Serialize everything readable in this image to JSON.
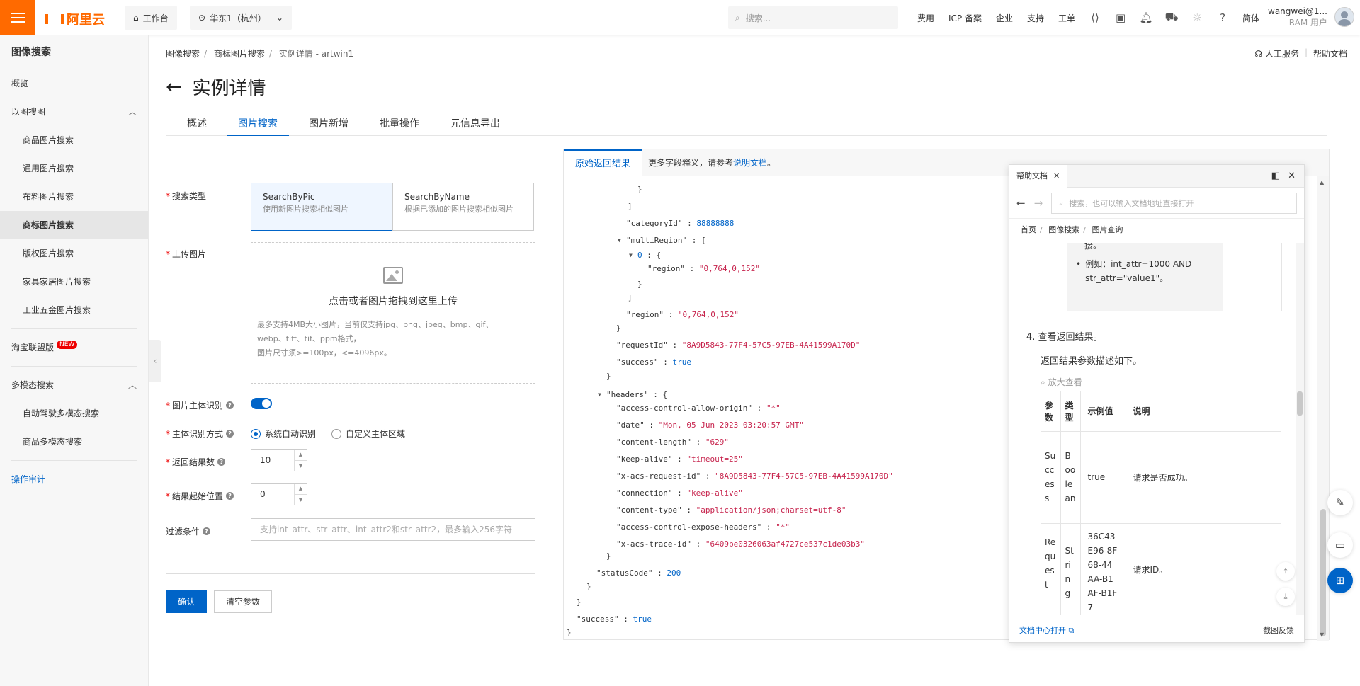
{
  "topbar": {
    "logo": "阿里云",
    "workbench": "工作台",
    "region": "华东1（杭州）",
    "search_placeholder": "搜索...",
    "links": [
      "费用",
      "ICP 备案",
      "企业",
      "支持",
      "工单"
    ],
    "lang": "简体",
    "user_name": "wangwei@1...",
    "user_role": "RAM 用户",
    "accent_color": "#ff6a00"
  },
  "sidebar": {
    "title": "图像搜索",
    "overview": "概览",
    "group1": "以图搜图",
    "group1_items": [
      "商品图片搜索",
      "通用图片搜索",
      "布料图片搜索",
      "商标图片搜索",
      "版权图片搜索",
      "家具家居图片搜索",
      "工业五金图片搜索"
    ],
    "taobao": "淘宝联盟版",
    "new_badge": "NEW",
    "group2": "多模态搜索",
    "group2_items": [
      "自动驾驶多模态搜索",
      "商品多模态搜索"
    ],
    "audit": "操作审计"
  },
  "header": {
    "breadcrumb": [
      "图像搜索",
      "商标图片搜索",
      "实例详情 - artwin1"
    ],
    "help_service": "人工服务",
    "help_doc": "帮助文档",
    "title": "实例详情",
    "tabs": [
      "概述",
      "图片搜索",
      "图片新增",
      "批量操作",
      "元信息导出"
    ],
    "active_tab": "图片搜索"
  },
  "form": {
    "search_type_label": "搜索类型",
    "search_types": [
      {
        "name": "SearchByPic",
        "desc": "使用新图片搜索相似图片"
      },
      {
        "name": "SearchByName",
        "desc": "根据已添加的图片搜索相似图片"
      }
    ],
    "upload_label": "上传图片",
    "upload_main": "点击或者图片拖拽到这里上传",
    "upload_hint1": "最多支持4MB大小图片，当前仅支持jpg、png、jpeg、bmp、gif、",
    "upload_hint2": "webp、tiff、tif、ppm格式，",
    "upload_hint3": "图片尺寸须>=100px，<=4096px。",
    "subject_label": "图片主体识别",
    "subject_mode_label": "主体识别方式",
    "subject_modes": [
      "系统自动识别",
      "自定义主体区域"
    ],
    "result_count_label": "返回结果数",
    "result_count": "10",
    "start_label": "结果起始位置",
    "start": "0",
    "filter_label": "过滤条件",
    "filter_placeholder": "支持int_attr、str_attr、int_attr2和str_attr2，最多输入256字符",
    "confirm": "确认",
    "clear": "清空参数"
  },
  "result": {
    "tab": "原始返回结果",
    "note_prefix": "更多字段释义，请参考",
    "note_link": "说明文档",
    "note_suffix": "。",
    "json_lines": [
      {
        "t": "}"
      },
      {
        "t": "]"
      },
      {
        "k": "categoryId",
        "v": "88888888",
        "vt": "n"
      },
      {
        "k": "multiRegion",
        "v": "[",
        "vt": "b",
        "toggle": true
      },
      {
        "k": "0",
        "v": "{",
        "vt": "b",
        "toggle": true,
        "kn": true
      },
      {
        "k": "region",
        "v": "\"0,764,0,152\"",
        "vt": "s"
      },
      {
        "t": "}"
      },
      {
        "t": "]"
      },
      {
        "k": "region",
        "v": "\"0,764,0,152\"",
        "vt": "s"
      },
      {
        "t": "}"
      },
      {
        "k": "requestId",
        "v": "\"8A9D5843-77F4-57C5-97EB-4A41599A170D\"",
        "vt": "s"
      },
      {
        "k": "success",
        "v": "true",
        "vt": "n"
      },
      {
        "t": "}"
      },
      {
        "k": "headers",
        "v": "{",
        "vt": "b",
        "toggle": true
      },
      {
        "k": "access-control-allow-origin",
        "v": "\"*\"",
        "vt": "s"
      },
      {
        "k": "date",
        "v": "\"Mon, 05 Jun 2023 03:20:57 GMT\"",
        "vt": "s"
      },
      {
        "k": "content-length",
        "v": "\"629\"",
        "vt": "s"
      },
      {
        "k": "keep-alive",
        "v": "\"timeout=25\"",
        "vt": "s"
      },
      {
        "k": "x-acs-request-id",
        "v": "\"8A9D5843-77F4-57C5-97EB-4A41599A170D\"",
        "vt": "s"
      },
      {
        "k": "connection",
        "v": "\"keep-alive\"",
        "vt": "s"
      },
      {
        "k": "content-type",
        "v": "\"application/json;charset=utf-8\"",
        "vt": "s"
      },
      {
        "k": "access-control-expose-headers",
        "v": "\"*\"",
        "vt": "s"
      },
      {
        "k": "x-acs-trace-id",
        "v": "\"6409be0326063af4727ce537c1de03b3\"",
        "vt": "s"
      },
      {
        "t": "}"
      },
      {
        "k": "statusCode",
        "v": "200",
        "vt": "n"
      },
      {
        "t": "}"
      },
      {
        "t": "}"
      },
      {
        "k": "success",
        "v": "true",
        "vt": "n"
      },
      {
        "t": "}"
      }
    ]
  },
  "doc": {
    "tab": "帮助文档",
    "search_placeholder": "搜索，也可以输入文档地址直接打开",
    "crumb": [
      "首页",
      "图像搜索",
      "图片查询"
    ],
    "frag1": "接。",
    "bullet": "例如：int_attr=1000 AND str_attr=\"value1\"。",
    "step": "查看返回结果。",
    "step_num": "4.",
    "step_desc": "返回结果参数描述如下。",
    "zoom": "放大查看",
    "table_headers": [
      "参数",
      "类型",
      "示例值",
      "说明"
    ],
    "rows": [
      {
        "p": "Success",
        "t": "Boolean",
        "v": "true",
        "d": "请求是否成功。"
      },
      {
        "p": "Request",
        "t": "String",
        "v": "36C43E96-8F68-44AA-B1AF-B1F7",
        "d": "请求ID。"
      }
    ],
    "open_center": "文档中心打开",
    "feedback": "截图反馈"
  }
}
